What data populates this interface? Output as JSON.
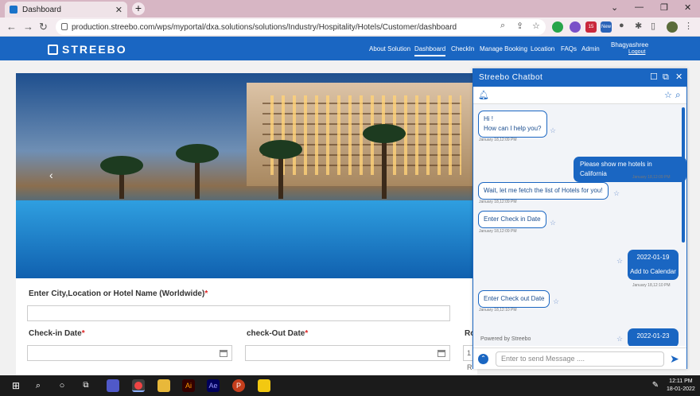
{
  "browser": {
    "tab_title": "Dashboard",
    "url": "production.streebo.com/wps/myportal/dxa.solutions/solutions/Industry/Hospitality/Hotels/Customer/dashboard",
    "ext_badge_15": "15",
    "ext_badge_new": "New"
  },
  "site": {
    "logo_text": "STREEBO",
    "nav": [
      "About Solution",
      "Dashboard",
      "CheckIn",
      "Manage Booking",
      "Location",
      "FAQs",
      "Admin"
    ],
    "active_nav": "Dashboard",
    "user_name": "Bhagyashree",
    "logout": "Logout"
  },
  "form": {
    "location_label": "Enter City,Location or Hotel Name (Worldwide)",
    "checkin_label": "Check-in Date",
    "checkout_label": "check-Out Date",
    "rooms_label": "Ro",
    "rooms_value": "1 R",
    "required_mark": "*"
  },
  "chatbot": {
    "title": "Streebo Chatbot",
    "messages": [
      {
        "from": "bot",
        "text": "Hi !",
        "text2": "How can I help you?",
        "time": "January 18,12:09 PM"
      },
      {
        "from": "user",
        "text": "Please show me hotels in California",
        "time": "January 18,12:09 PM"
      },
      {
        "from": "bot",
        "text": "Wait, let me fetch the list of Hotels for you!",
        "time": "January 18,12:09 PM"
      },
      {
        "from": "bot",
        "text": "Enter Check in Date",
        "time": "January 18,12:09 PM"
      },
      {
        "from": "user",
        "text": "2022-01-19",
        "text2": "Add to Calendar",
        "time": "January 18,12:10 PM"
      },
      {
        "from": "bot",
        "text": "Enter Check out Date",
        "time": "January 18,12:10 PM"
      },
      {
        "from": "user",
        "text": "2022-01-23"
      }
    ],
    "powered_by": "Powered by Streebo",
    "input_placeholder": "Enter to send Message ...."
  },
  "taskbar": {
    "time": "12:11 PM",
    "date": "18-01-2022",
    "apps": [
      "Ai",
      "Ae",
      "P"
    ]
  },
  "colors": {
    "brand": "#1a66c2",
    "tab_bar": "#d7b6c4"
  }
}
